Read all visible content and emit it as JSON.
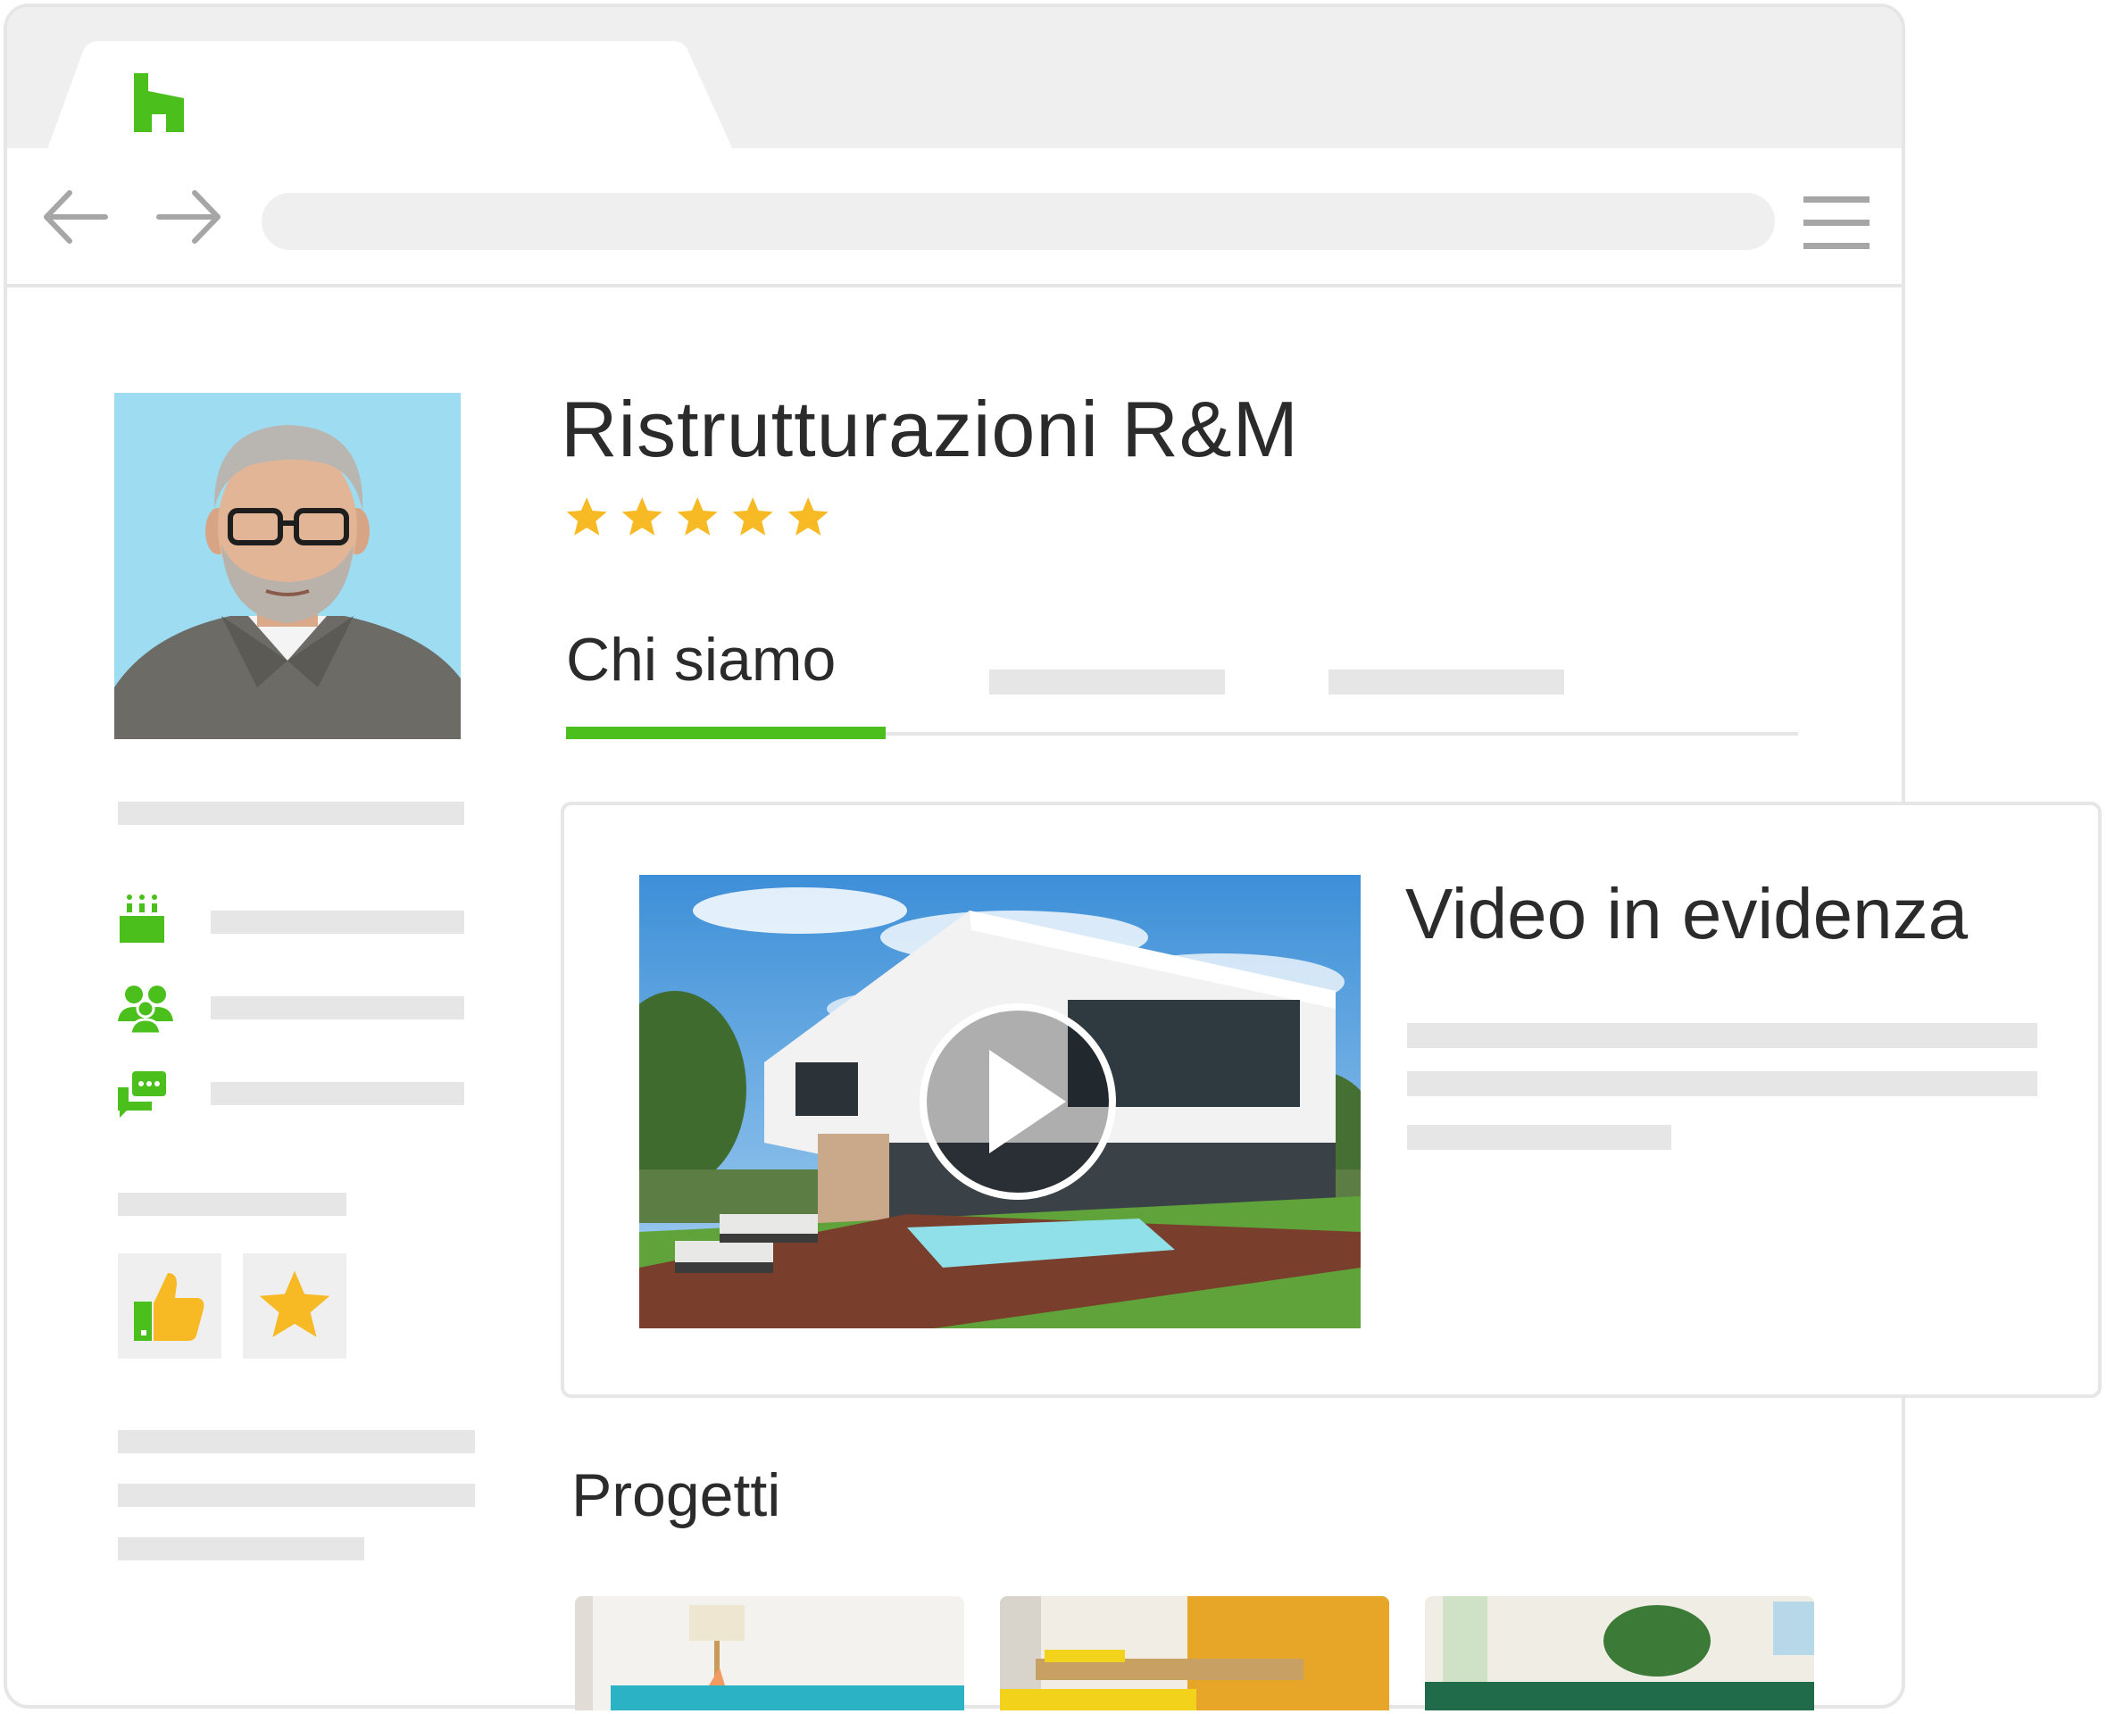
{
  "browser": {
    "logo_icon": "houzz-h-icon",
    "nav": [
      "arrow-left-icon",
      "arrow-right-icon"
    ],
    "menu_icon": "hamburger-menu-icon"
  },
  "profile": {
    "company_name": "Ristrutturazioni R&M",
    "rating": 5,
    "rating_max": 5
  },
  "tabs": {
    "active_label": "Chi siamo"
  },
  "featured": {
    "title": "Video in evidenza"
  },
  "projects": {
    "title": "Progetti"
  },
  "sidebar_icons": [
    "calendar-cake-icon",
    "team-icon",
    "chat-bubbles-icon"
  ],
  "badges": [
    "thumbs-up-icon",
    "star-award-icon"
  ],
  "colors": {
    "brand_green": "#4bbf1b",
    "star_gold": "#f7b924",
    "placeholder_gray": "#e6e6e6"
  }
}
